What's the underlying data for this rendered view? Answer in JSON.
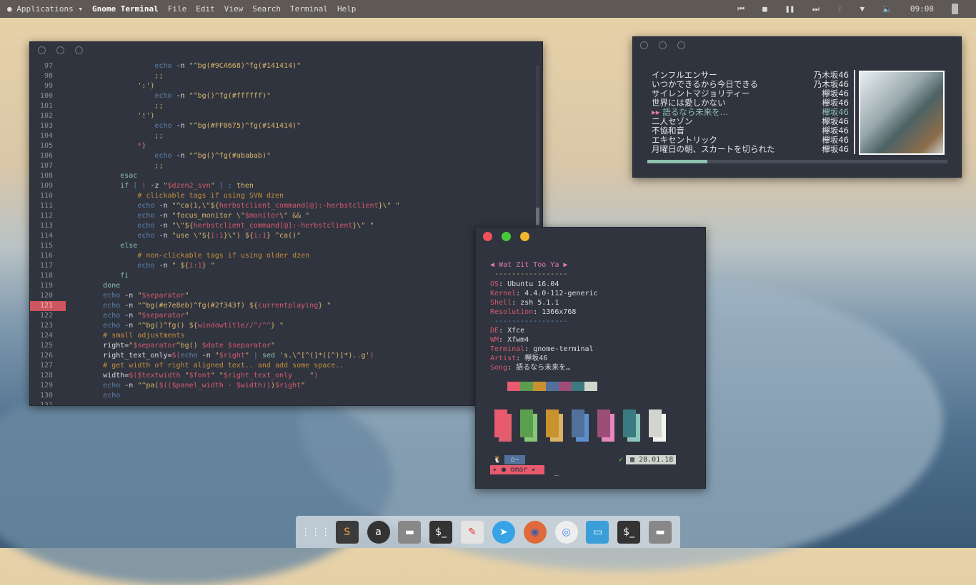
{
  "topbar": {
    "apps": "Applications",
    "app_title": "Gnome Terminal",
    "menu": [
      "File",
      "Edit",
      "View",
      "Search",
      "Terminal",
      "Help"
    ],
    "clock": "09:08"
  },
  "editor": {
    "highlighted_line": 121,
    "lines": [
      {
        "n": 97,
        "i": 5,
        "t": [
          [
            "k",
            "echo "
          ],
          [
            "p",
            "-n "
          ],
          [
            "s",
            "\"^bg(#9CA668)^fg(#141414)\""
          ]
        ]
      },
      {
        "n": 98,
        "i": 5,
        "t": [
          [
            "s",
            ";;"
          ]
        ]
      },
      {
        "n": 99,
        "i": 4,
        "t": [
          [
            "s",
            "':')"
          ]
        ]
      },
      {
        "n": 100,
        "i": 5,
        "t": [
          [
            "k",
            "echo "
          ],
          [
            "p",
            "-n "
          ],
          [
            "s",
            "\"^bg()^fg(#ffffff)\""
          ]
        ]
      },
      {
        "n": 101,
        "i": 5,
        "t": [
          [
            "s",
            ";;"
          ]
        ]
      },
      {
        "n": 102,
        "i": 4,
        "t": [
          [
            "s",
            "'!')"
          ]
        ]
      },
      {
        "n": 103,
        "i": 5,
        "t": [
          [
            "k",
            "echo "
          ],
          [
            "p",
            "-n "
          ],
          [
            "s",
            "\"^bg(#FF0675)^fg(#141414)\""
          ]
        ]
      },
      {
        "n": 104,
        "i": 5,
        "t": [
          [
            "s",
            ";;"
          ]
        ]
      },
      {
        "n": 105,
        "i": 4,
        "t": [
          [
            "v",
            "*"
          ],
          [
            "s",
            ")"
          ]
        ]
      },
      {
        "n": 106,
        "i": 5,
        "t": [
          [
            "k",
            "echo "
          ],
          [
            "p",
            "-n "
          ],
          [
            "s",
            "\"^bg()^fg(#ababab)\""
          ]
        ]
      },
      {
        "n": 107,
        "i": 5,
        "t": [
          [
            "s",
            ";;"
          ]
        ]
      },
      {
        "n": 108,
        "i": 3,
        "t": [
          [
            "f",
            "esac"
          ]
        ]
      },
      {
        "n": 109,
        "i": 3,
        "t": [
          [
            "f",
            "if "
          ],
          [
            "k",
            "[ "
          ],
          [
            "v",
            "! "
          ],
          [
            "p",
            "-z "
          ],
          [
            "s",
            "\""
          ],
          [
            "v",
            "$dzen2_svn"
          ],
          [
            "s",
            "\" "
          ],
          [
            "k",
            "] ; "
          ],
          [
            "s",
            "then"
          ]
        ]
      },
      {
        "n": 110,
        "i": 4,
        "t": [
          [
            "c",
            "# clickable tags if using SVN dzen"
          ]
        ]
      },
      {
        "n": 111,
        "i": 4,
        "t": [
          [
            "k",
            "echo "
          ],
          [
            "p",
            "-n "
          ],
          [
            "s",
            "\"^ca(1,\\\"${"
          ],
          [
            "v",
            "herbstclient_command[@]:-herbstclient"
          ],
          [
            "s",
            "}\\\" \""
          ]
        ]
      },
      {
        "n": 112,
        "i": 4,
        "t": [
          [
            "k",
            "echo "
          ],
          [
            "p",
            "-n "
          ],
          [
            "s",
            "\"focus_monitor \\\""
          ],
          [
            "v",
            "$monitor"
          ],
          [
            "s",
            "\\\" && \""
          ]
        ]
      },
      {
        "n": 113,
        "i": 4,
        "t": [
          [
            "k",
            "echo "
          ],
          [
            "p",
            "-n "
          ],
          [
            "s",
            "\"\\\"${"
          ],
          [
            "v",
            "herbstclient_command[@]:-herbstclient"
          ],
          [
            "s",
            "}\\\" \""
          ]
        ]
      },
      {
        "n": 114,
        "i": 4,
        "t": [
          [
            "k",
            "echo "
          ],
          [
            "p",
            "-n "
          ],
          [
            "s",
            "\"use \\\"${"
          ],
          [
            "v",
            "i:1"
          ],
          [
            "s",
            "}\\\") ${"
          ],
          [
            "v",
            "i:1"
          ],
          [
            "s",
            "} ^ca()\""
          ]
        ]
      },
      {
        "n": 115,
        "i": 3,
        "t": [
          [
            "f",
            "else"
          ]
        ]
      },
      {
        "n": 116,
        "i": 4,
        "t": [
          [
            "c",
            "# non-clickable tags if using older dzen"
          ]
        ]
      },
      {
        "n": 117,
        "i": 4,
        "t": [
          [
            "k",
            "echo "
          ],
          [
            "p",
            "-n "
          ],
          [
            "s",
            "\" ${"
          ],
          [
            "v",
            "i:1"
          ],
          [
            "s",
            "} \""
          ]
        ]
      },
      {
        "n": 118,
        "i": 3,
        "t": [
          [
            "f",
            "fi"
          ]
        ]
      },
      {
        "n": 119,
        "i": 2,
        "t": [
          [
            "f",
            "done"
          ]
        ]
      },
      {
        "n": 120,
        "i": 2,
        "t": [
          [
            "k",
            "echo "
          ],
          [
            "p",
            "-n "
          ],
          [
            "s",
            "\""
          ],
          [
            "v",
            "$separator"
          ],
          [
            "s",
            "\""
          ]
        ]
      },
      {
        "n": 121,
        "i": 2,
        "t": [
          [
            "k",
            "echo "
          ],
          [
            "p",
            "-n "
          ],
          [
            "s",
            "\"^bg(#e7e8eb)^fg(#2f343f) ${"
          ],
          [
            "v",
            "currentplaying"
          ],
          [
            "s",
            "} \""
          ]
        ]
      },
      {
        "n": 122,
        "i": 2,
        "t": [
          [
            "k",
            "echo "
          ],
          [
            "p",
            "-n "
          ],
          [
            "s",
            "\""
          ],
          [
            "v",
            "$separator"
          ],
          [
            "s",
            "\""
          ]
        ]
      },
      {
        "n": 123,
        "i": 2,
        "t": [
          [
            "k",
            "echo "
          ],
          [
            "p",
            "-n "
          ],
          [
            "s",
            "\"^bg()^fg() ${"
          ],
          [
            "v",
            "windowtitle//^/^^"
          ],
          [
            "s",
            "} \""
          ]
        ]
      },
      {
        "n": 124,
        "i": 2,
        "t": [
          [
            "c",
            "# small adjustments"
          ]
        ]
      },
      {
        "n": 125,
        "i": 2,
        "t": [
          [
            "p",
            "right="
          ],
          [
            "s",
            "\""
          ],
          [
            "v",
            "$separator"
          ],
          [
            "s",
            "^bg() "
          ],
          [
            "v",
            "$date $separator"
          ],
          [
            "s",
            "\""
          ]
        ]
      },
      {
        "n": 126,
        "i": 2,
        "t": [
          [
            "p",
            "right_text_only="
          ],
          [
            "v",
            "$("
          ],
          [
            "k",
            "echo "
          ],
          [
            "p",
            "-n "
          ],
          [
            "s",
            "\""
          ],
          [
            "v",
            "$right"
          ],
          [
            "s",
            "\" "
          ],
          [
            "k",
            "| "
          ],
          [
            "f",
            "sed "
          ],
          [
            "s",
            "'s.\\^[^(]*([^)]*)..g'"
          ],
          [
            "v",
            ")"
          ]
        ]
      },
      {
        "n": 127,
        "i": 2,
        "t": [
          [
            "c",
            "# get width of right aligned text.. and add some space.."
          ]
        ]
      },
      {
        "n": 128,
        "i": 2,
        "t": [
          [
            "p",
            "width="
          ],
          [
            "v",
            "$($textwidth "
          ],
          [
            "s",
            "\""
          ],
          [
            "v",
            "$font"
          ],
          [
            "s",
            "\" \""
          ],
          [
            "v",
            "$right_text_only"
          ],
          [
            "s",
            "    \""
          ],
          [
            "v",
            ")"
          ]
        ]
      },
      {
        "n": 129,
        "i": 2,
        "t": [
          [
            "k",
            "echo "
          ],
          [
            "p",
            "-n "
          ],
          [
            "s",
            "\"^pa("
          ],
          [
            "v",
            "$(($panel_width - $width))"
          ],
          [
            "s",
            ")"
          ],
          [
            "v",
            "$right"
          ],
          [
            "s",
            "\""
          ]
        ]
      },
      {
        "n": 130,
        "i": 2,
        "t": [
          [
            "k",
            "echo"
          ]
        ]
      },
      {
        "n": 131,
        "i": 0,
        "t": []
      }
    ]
  },
  "term": {
    "title": "Wat Zit Too Ya",
    "sep": "-----------------",
    "info1": [
      [
        "OS",
        "Ubuntu 16.04"
      ],
      [
        "Kernel",
        "4.4.0-112-generic"
      ],
      [
        "Shell",
        "zsh 5.1.1"
      ],
      [
        "Resolution",
        "1366x768"
      ]
    ],
    "info2": [
      [
        "DE",
        "Xfce"
      ],
      [
        "WM",
        "Xfwm4"
      ],
      [
        "Terminal",
        "gnome-terminal"
      ],
      [
        "Artist",
        "欅坂46"
      ],
      [
        "Song",
        "語るなら未来を…"
      ]
    ],
    "palette": [
      "#e85a6e",
      "#5b9e4d",
      "#c8922f",
      "#52719a",
      "#9c4d78",
      "#3b7a80",
      "#d2d4ce"
    ],
    "palette_light": [
      "#e0606e",
      "#86c779",
      "#dcb264",
      "#5d8fcc",
      "#e588c0",
      "#8ec4ba",
      "#f2f2ee"
    ],
    "prompt_dir": "~",
    "prompt_user": "omar",
    "date": "28.01.18",
    "cursor": "_"
  },
  "music": {
    "progress": 0.2,
    "tracks": [
      [
        "インフルエンサー",
        "乃木坂46"
      ],
      [
        "いつかできるから今日できる",
        "乃木坂46"
      ],
      [
        "サイレントマジョリティー",
        "欅坂46"
      ],
      [
        "世界には愛しかない",
        "欅坂46"
      ],
      [
        "語るなら未来を…",
        "欅坂46"
      ],
      [
        "二人セゾン",
        "欅坂46"
      ],
      [
        "不協和音",
        "欅坂46"
      ],
      [
        "エキセントリック",
        "欅坂46"
      ],
      [
        "月曜日の朝、スカートを切られた",
        "欅坂46"
      ]
    ],
    "current": 4,
    "playing_icon": "▸▸"
  },
  "dock": [
    "app-grid",
    "sublime-text",
    "amazon",
    "files",
    "terminal",
    "text-editor",
    "telegram",
    "firefox",
    "chrome",
    "window-manager",
    "terminal",
    "files"
  ]
}
